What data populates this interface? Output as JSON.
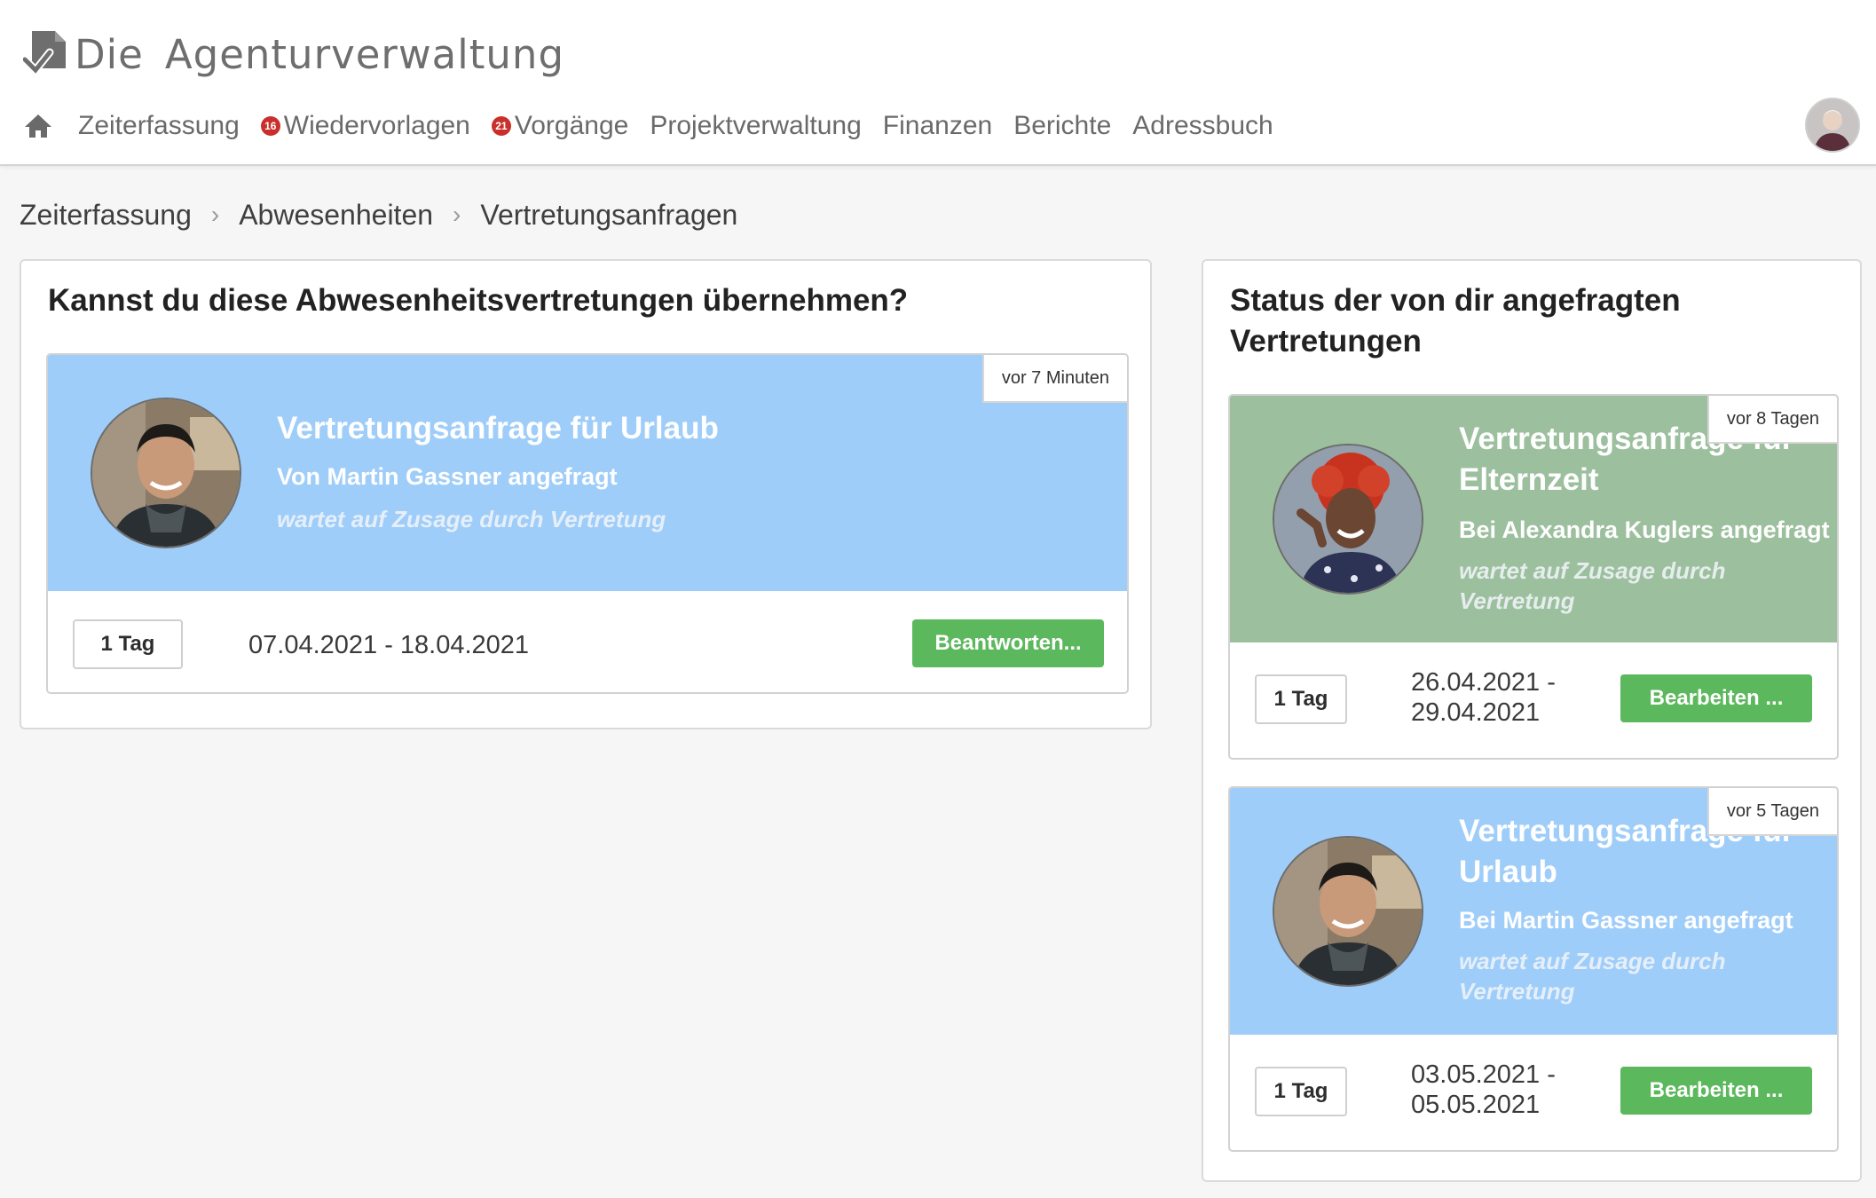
{
  "app": {
    "logo_text_1": "Die",
    "logo_text_2": "Agenturverwaltung"
  },
  "nav": {
    "home_icon": "home-icon",
    "items": [
      {
        "label": "Zeiterfassung"
      },
      {
        "label": "Wiedervorlagen",
        "badge": "16"
      },
      {
        "label": "Vorgänge",
        "badge": "21"
      },
      {
        "label": "Projektverwaltung"
      },
      {
        "label": "Finanzen"
      },
      {
        "label": "Berichte"
      },
      {
        "label": "Adressbuch"
      }
    ]
  },
  "breadcrumb": [
    "Zeiterfassung",
    "Abwesenheiten",
    "Vertretungsanfragen"
  ],
  "incoming": {
    "title": "Kannst du diese Abwesenheitsvertretungen übernehmen?",
    "card": {
      "time": "vor 7 Minuten",
      "title": "Vertretungsanfrage für Urlaub",
      "subtitle": "Von Martin Gassner angefragt",
      "status": "wartet auf Zusage durch Vertretung",
      "days": "1 Tag",
      "dates": "07.04.2021 - 18.04.2021",
      "button": "Beantworten..."
    }
  },
  "outgoing": {
    "title_line1": "Status der von dir angefragten",
    "title_line2": "Vertretungen",
    "cards": [
      {
        "time": "vor 8 Tagen",
        "title_line1": "Vertretungsanfrage für",
        "title_line2": "Elternzeit",
        "subtitle": "Bei Alexandra Kuglers angefragt",
        "status_line1": "wartet auf Zusage durch",
        "status_line2": "Vertretung",
        "days": "1 Tag",
        "dates_line1": "26.04.2021 -",
        "dates_line2": "29.04.2021",
        "button": "Bearbeiten ..."
      },
      {
        "time": "vor 5 Tagen",
        "title_line1": "Vertretungsanfrage für",
        "title_line2": "Urlaub",
        "subtitle": "Bei Martin Gassner angefragt",
        "status_line1": "wartet auf Zusage durch",
        "status_line2": "Vertretung",
        "days": "1 Tag",
        "dates_line1": "03.05.2021 -",
        "dates_line2": "05.05.2021",
        "button": "Bearbeiten ..."
      }
    ]
  },
  "colors": {
    "blue_card": "#9fcdf9",
    "green_card": "#9cbf9e",
    "button": "#5cb85c",
    "badge": "#c9302c"
  }
}
